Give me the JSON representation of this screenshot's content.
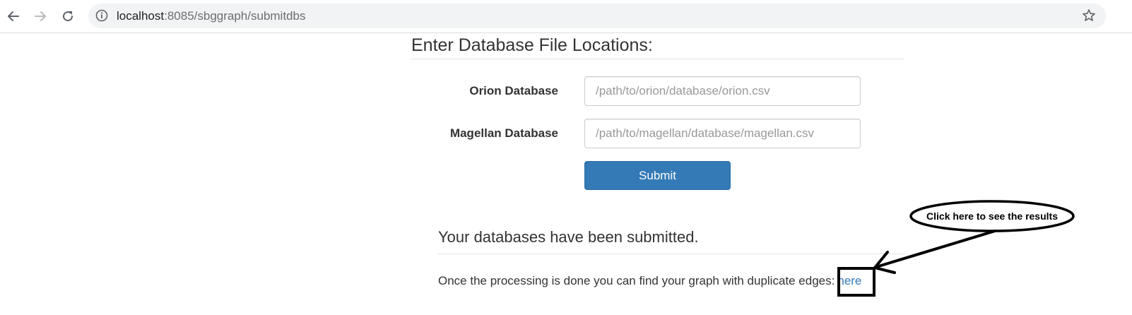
{
  "browser": {
    "url_host": "localhost",
    "url_rest": ":8085/sbggraph/submitdbs",
    "icons": {
      "back": "back-arrow-icon",
      "forward": "forward-arrow-icon",
      "reload": "reload-icon",
      "info": "info-icon",
      "bookmark": "star-icon"
    }
  },
  "form": {
    "heading": "Enter Database File Locations:",
    "fields": [
      {
        "label": "Orion Database",
        "placeholder": "/path/to/orion/database/orion.csv",
        "value": ""
      },
      {
        "label": "Magellan Database",
        "placeholder": "/path/to/magellan/database/magellan.csv",
        "value": ""
      }
    ],
    "submit_label": "Submit"
  },
  "result": {
    "heading": "Your databases have been submitted.",
    "text": "Once the processing is done you can find your graph with duplicate edges:",
    "link_label": "here"
  },
  "annotation": {
    "callout": "Click here to see the results"
  },
  "colors": {
    "primary": "#337ab7",
    "link": "#337ab7",
    "omnibox_bg": "#f1f3f4",
    "annotation": "#000000"
  }
}
